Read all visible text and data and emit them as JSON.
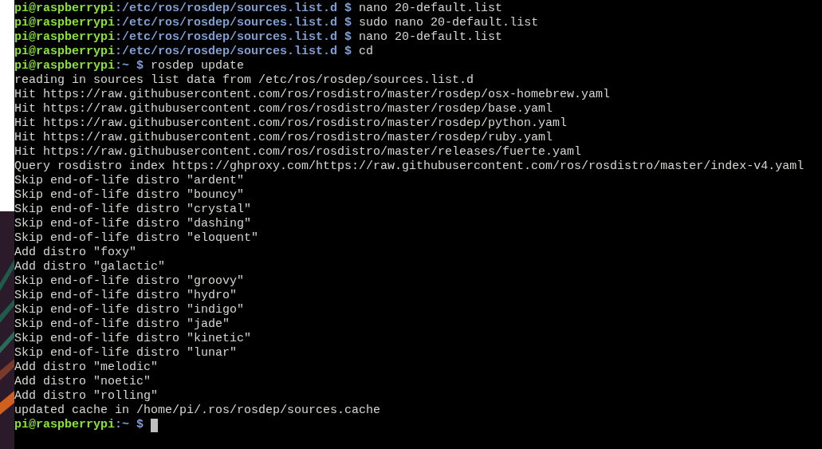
{
  "terminal": {
    "lines": [
      {
        "kind": "prompt",
        "host": "pi@raspberrypi",
        "path": ":/etc/ros/rosdep/sources.list.d $",
        "command": "nano 20-default.list"
      },
      {
        "kind": "prompt",
        "host": "pi@raspberrypi",
        "path": ":/etc/ros/rosdep/sources.list.d $",
        "command": "sudo nano 20-default.list"
      },
      {
        "kind": "prompt",
        "host": "pi@raspberrypi",
        "path": ":/etc/ros/rosdep/sources.list.d $",
        "command": "nano 20-default.list"
      },
      {
        "kind": "prompt",
        "host": "pi@raspberrypi",
        "path": ":/etc/ros/rosdep/sources.list.d $",
        "command": "cd"
      },
      {
        "kind": "prompt",
        "host": "pi@raspberrypi",
        "path": ":~ $",
        "command": "rosdep update"
      },
      {
        "kind": "output",
        "text": "reading in sources list data from /etc/ros/rosdep/sources.list.d"
      },
      {
        "kind": "output",
        "text": "Hit https://raw.githubusercontent.com/ros/rosdistro/master/rosdep/osx-homebrew.yaml"
      },
      {
        "kind": "output",
        "text": "Hit https://raw.githubusercontent.com/ros/rosdistro/master/rosdep/base.yaml"
      },
      {
        "kind": "output",
        "text": "Hit https://raw.githubusercontent.com/ros/rosdistro/master/rosdep/python.yaml"
      },
      {
        "kind": "output",
        "text": "Hit https://raw.githubusercontent.com/ros/rosdistro/master/rosdep/ruby.yaml"
      },
      {
        "kind": "output",
        "text": "Hit https://raw.githubusercontent.com/ros/rosdistro/master/releases/fuerte.yaml"
      },
      {
        "kind": "output",
        "text": "Query rosdistro index https://ghproxy.com/https://raw.githubusercontent.com/ros/rosdistro/master/index-v4.yaml"
      },
      {
        "kind": "output",
        "text": "Skip end-of-life distro \"ardent\""
      },
      {
        "kind": "output",
        "text": "Skip end-of-life distro \"bouncy\""
      },
      {
        "kind": "output",
        "text": "Skip end-of-life distro \"crystal\""
      },
      {
        "kind": "output",
        "text": "Skip end-of-life distro \"dashing\""
      },
      {
        "kind": "output",
        "text": "Skip end-of-life distro \"eloquent\""
      },
      {
        "kind": "output",
        "text": "Add distro \"foxy\""
      },
      {
        "kind": "output",
        "text": "Add distro \"galactic\""
      },
      {
        "kind": "output",
        "text": "Skip end-of-life distro \"groovy\""
      },
      {
        "kind": "output",
        "text": "Skip end-of-life distro \"hydro\""
      },
      {
        "kind": "output",
        "text": "Skip end-of-life distro \"indigo\""
      },
      {
        "kind": "output",
        "text": "Skip end-of-life distro \"jade\""
      },
      {
        "kind": "output",
        "text": "Skip end-of-life distro \"kinetic\""
      },
      {
        "kind": "output",
        "text": "Skip end-of-life distro \"lunar\""
      },
      {
        "kind": "output",
        "text": "Add distro \"melodic\""
      },
      {
        "kind": "output",
        "text": "Add distro \"noetic\""
      },
      {
        "kind": "output",
        "text": "Add distro \"rolling\""
      },
      {
        "kind": "output",
        "text": "updated cache in /home/pi/.ros/rosdep/sources.cache"
      },
      {
        "kind": "prompt",
        "host": "pi@raspberrypi",
        "path": ":~ $",
        "cursor": true
      }
    ]
  }
}
